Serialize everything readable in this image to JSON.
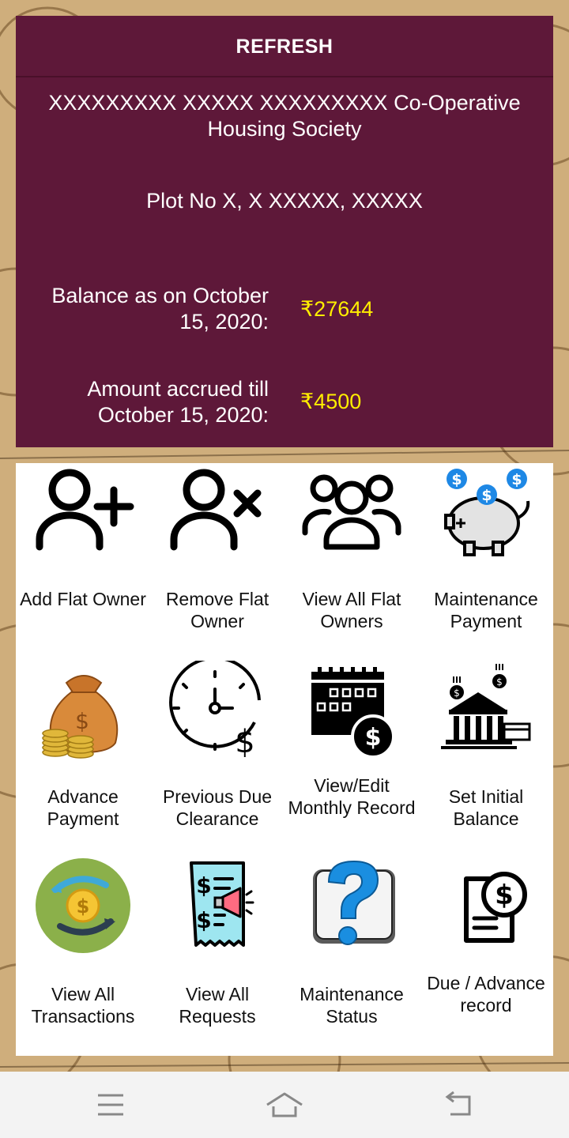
{
  "header": {
    "refresh_label": "REFRESH",
    "society_name": "XXXXXXXXX XXXXX XXXXXXXXX Co-Operative Housing Society",
    "address": "Plot No X, X XXXXX, XXXXX"
  },
  "summary": {
    "balance_label": "Balance as on October 15, 2020:",
    "balance_value": "₹27644",
    "accrued_label": "Amount accrued till October 15, 2020:",
    "accrued_value": "₹4500",
    "value_color": "#ffee00"
  },
  "menu": [
    {
      "label": "Add Flat Owner",
      "icon": "add-user-icon"
    },
    {
      "label": "Remove Flat Owner",
      "icon": "remove-user-icon"
    },
    {
      "label": "View All Flat Owners",
      "icon": "users-group-icon"
    },
    {
      "label": "Maintenance Payment",
      "icon": "piggy-bank-icon"
    },
    {
      "label": "Advance Payment",
      "icon": "money-bag-icon"
    },
    {
      "label": "Previous Due Clearance",
      "icon": "clock-dollar-icon"
    },
    {
      "label": "View/Edit Monthly Record",
      "icon": "calendar-dollar-icon"
    },
    {
      "label": "Set Initial Balance",
      "icon": "bank-icon"
    },
    {
      "label": "View All Transactions",
      "icon": "coin-transfer-icon"
    },
    {
      "label": "View All Requests",
      "icon": "receipt-megaphone-icon"
    },
    {
      "label": "Maintenance Status",
      "icon": "question-mark-icon"
    },
    {
      "label": "Due / Advance record",
      "icon": "dollar-document-icon"
    }
  ],
  "colors": {
    "panel": "#5e1839",
    "accent_blue": "#1e88e5"
  },
  "navbar": {
    "icons": [
      "menu-icon",
      "home-icon",
      "back-icon"
    ]
  }
}
